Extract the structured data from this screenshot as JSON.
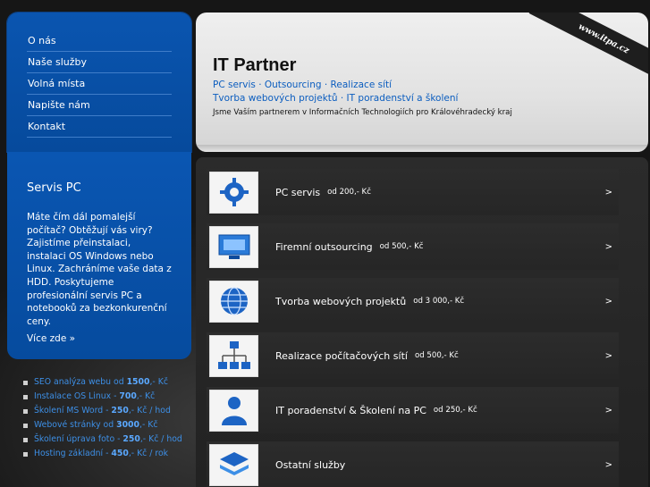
{
  "nav": {
    "items": [
      {
        "label": "O nás"
      },
      {
        "label": "Naše služby"
      },
      {
        "label": "Volná místa"
      },
      {
        "label": "Napište nám"
      },
      {
        "label": "Kontakt"
      }
    ]
  },
  "servis": {
    "title": "Servis PC",
    "text": "Máte čím dál pomalejší počítač? Obtěžují vás viry? Zajistíme přeinstalaci, instalaci OS Windows nebo Linux. Zachráníme vaše data z HDD. Poskytujeme profesionální servis PC a notebooků za bezkonkurenční ceny.",
    "more": "Více zde »"
  },
  "prices": [
    {
      "text": "SEO analýza webu od ",
      "value": "1500",
      "unit": ",- Kč"
    },
    {
      "text": "Instalace OS Linux - ",
      "value": "700",
      "unit": ",- Kč"
    },
    {
      "text": "Školení MS Word - ",
      "value": "250",
      "unit": ",- Kč / hod"
    },
    {
      "text": "Webové stránky od ",
      "value": "3000",
      "unit": ",- Kč"
    },
    {
      "text": "Školení úprava foto - ",
      "value": "250",
      "unit": ",- Kč / hod"
    },
    {
      "text": "Hosting základní - ",
      "value": "450",
      "unit": ",- Kč / rok"
    }
  ],
  "header": {
    "title": "IT Partner",
    "line1": "PC servis · Outsourcing · Realizace sítí",
    "line2": "Tvorba webových projektů · IT poradenství a školení",
    "line3": "Jsme Vaším partnerem v Informačních Technologiích pro Královéhradecký kraj",
    "ribbon": "www.itpa.cz"
  },
  "services": [
    {
      "label": "PC servis",
      "price": "od 200,- Kč",
      "arrow": ">",
      "icon": "gear-icon"
    },
    {
      "label": "Firemní outsourcing",
      "price": "od 500,- Kč",
      "arrow": ">",
      "icon": "monitor-icon"
    },
    {
      "label": "Tvorba webových projektů",
      "price": "od 3 000,- Kč",
      "arrow": ">",
      "icon": "globe-icon"
    },
    {
      "label": "Realizace počítačových sítí",
      "price": "od 500,- Kč",
      "arrow": ">",
      "icon": "network-icon"
    },
    {
      "label": "IT poradenství & Školení na PC",
      "price": "od 250,- Kč",
      "arrow": ">",
      "icon": "user-icon"
    },
    {
      "label": "Ostatní služby",
      "price": "",
      "arrow": ">",
      "icon": "stack-icon"
    }
  ],
  "colors": {
    "blue": "#0a55b0",
    "link": "#3d8fe6",
    "header_text": "#0b5dbf"
  }
}
